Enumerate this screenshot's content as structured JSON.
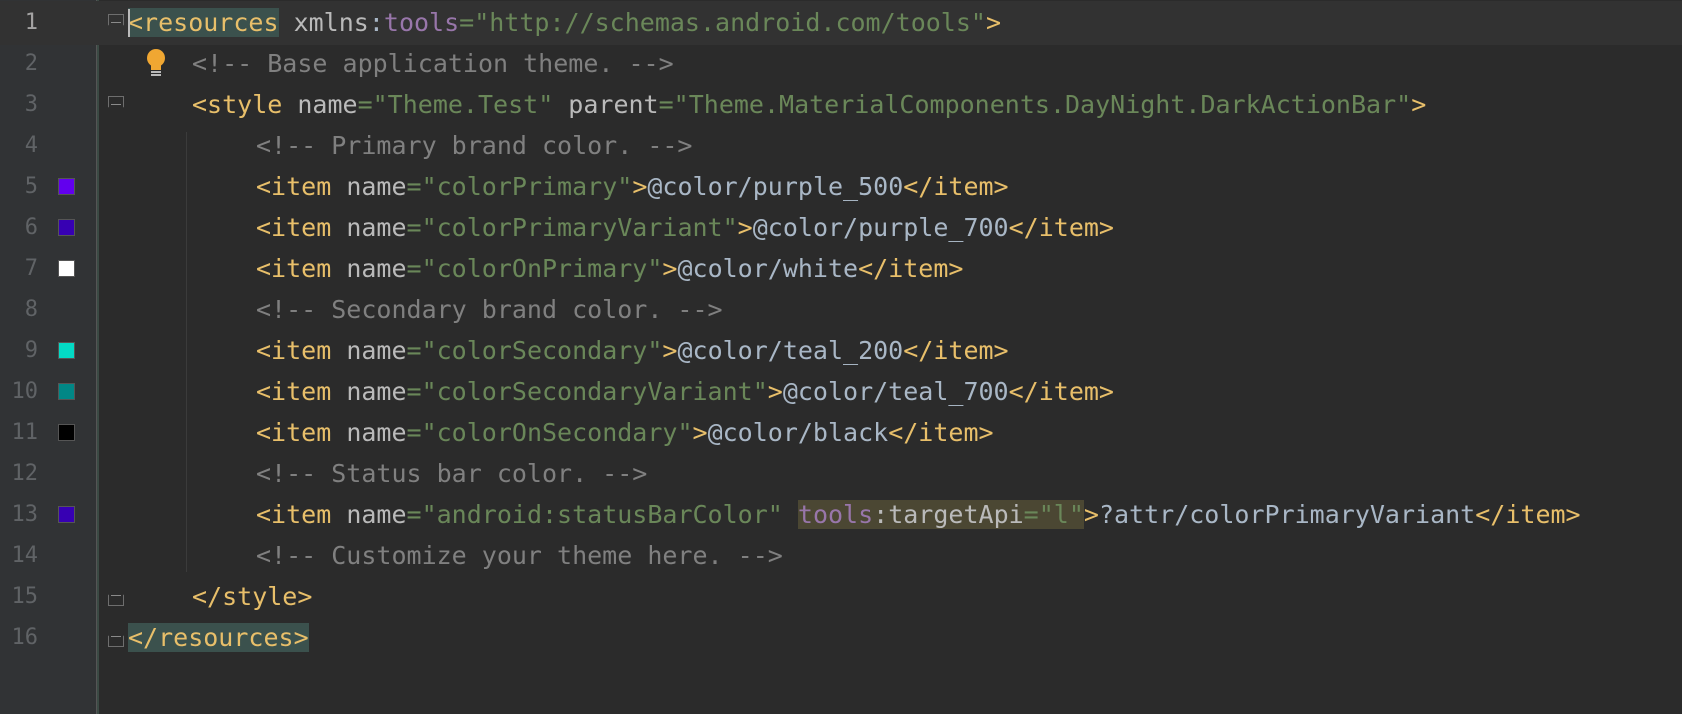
{
  "editor": {
    "file_type": "xml",
    "lines": [
      {
        "n": "1",
        "indent": 0,
        "fold": "start",
        "current": true,
        "tokens": [
          {
            "c": "tag",
            "t": "<resources",
            "hl": "tag"
          },
          {
            "c": "attr",
            "t": " xmlns"
          },
          {
            "c": "txt",
            "t": ":"
          },
          {
            "c": "ns",
            "t": "tools"
          },
          {
            "c": "val",
            "t": "=\"http://schemas.android.com/tools\""
          },
          {
            "c": "tag",
            "t": ">"
          }
        ]
      },
      {
        "n": "2",
        "indent": 1,
        "bulb": true,
        "tokens": [
          {
            "c": "cmt",
            "t": "<!-- Base application theme. -->"
          }
        ]
      },
      {
        "n": "3",
        "indent": 1,
        "fold": "start",
        "tokens": [
          {
            "c": "tag",
            "t": "<style"
          },
          {
            "c": "attr",
            "t": " name"
          },
          {
            "c": "val",
            "t": "=\"Theme.Test\""
          },
          {
            "c": "attr",
            "t": " parent"
          },
          {
            "c": "val",
            "t": "=\"Theme.MaterialComponents.DayNight.DarkActionBar\""
          },
          {
            "c": "tag",
            "t": ">"
          }
        ]
      },
      {
        "n": "4",
        "indent": 2,
        "tokens": [
          {
            "c": "cmt",
            "t": "<!-- Primary brand color. -->"
          }
        ]
      },
      {
        "n": "5",
        "indent": 2,
        "swatch": "#6200ee",
        "tokens": [
          {
            "c": "tag",
            "t": "<item"
          },
          {
            "c": "attr",
            "t": " name"
          },
          {
            "c": "val",
            "t": "=\"colorPrimary\""
          },
          {
            "c": "tag",
            "t": ">"
          },
          {
            "c": "txt",
            "t": "@color/purple_500"
          },
          {
            "c": "tag",
            "t": "</item>"
          }
        ]
      },
      {
        "n": "6",
        "indent": 2,
        "swatch": "#3700b3",
        "tokens": [
          {
            "c": "tag",
            "t": "<item"
          },
          {
            "c": "attr",
            "t": " name"
          },
          {
            "c": "val",
            "t": "=\"colorPrimaryVariant\""
          },
          {
            "c": "tag",
            "t": ">"
          },
          {
            "c": "txt",
            "t": "@color/purple_700"
          },
          {
            "c": "tag",
            "t": "</item>"
          }
        ]
      },
      {
        "n": "7",
        "indent": 2,
        "swatch": "#ffffff",
        "tokens": [
          {
            "c": "tag",
            "t": "<item"
          },
          {
            "c": "attr",
            "t": " name"
          },
          {
            "c": "val",
            "t": "=\"colorOnPrimary\""
          },
          {
            "c": "tag",
            "t": ">"
          },
          {
            "c": "txt",
            "t": "@color/white"
          },
          {
            "c": "tag",
            "t": "</item>"
          }
        ]
      },
      {
        "n": "8",
        "indent": 2,
        "tokens": [
          {
            "c": "cmt",
            "t": "<!-- Secondary brand color. -->"
          }
        ]
      },
      {
        "n": "9",
        "indent": 2,
        "swatch": "#03dac5",
        "tokens": [
          {
            "c": "tag",
            "t": "<item"
          },
          {
            "c": "attr",
            "t": " name"
          },
          {
            "c": "val",
            "t": "=\"colorSecondary\""
          },
          {
            "c": "tag",
            "t": ">"
          },
          {
            "c": "txt",
            "t": "@color/teal_200"
          },
          {
            "c": "tag",
            "t": "</item>"
          }
        ]
      },
      {
        "n": "10",
        "indent": 2,
        "swatch": "#018786",
        "tokens": [
          {
            "c": "tag",
            "t": "<item"
          },
          {
            "c": "attr",
            "t": " name"
          },
          {
            "c": "val",
            "t": "=\"colorSecondaryVariant\""
          },
          {
            "c": "tag",
            "t": ">"
          },
          {
            "c": "txt",
            "t": "@color/teal_700"
          },
          {
            "c": "tag",
            "t": "</item>"
          }
        ]
      },
      {
        "n": "11",
        "indent": 2,
        "swatch": "#000000",
        "tokens": [
          {
            "c": "tag",
            "t": "<item"
          },
          {
            "c": "attr",
            "t": " name"
          },
          {
            "c": "val",
            "t": "=\"colorOnSecondary\""
          },
          {
            "c": "tag",
            "t": ">"
          },
          {
            "c": "txt",
            "t": "@color/black"
          },
          {
            "c": "tag",
            "t": "</item>"
          }
        ]
      },
      {
        "n": "12",
        "indent": 2,
        "tokens": [
          {
            "c": "cmt",
            "t": "<!-- Status bar color. -->"
          }
        ]
      },
      {
        "n": "13",
        "indent": 2,
        "swatch": "#3700b3",
        "tokens": [
          {
            "c": "tag",
            "t": "<item"
          },
          {
            "c": "attr",
            "t": " name"
          },
          {
            "c": "val",
            "t": "=\"android:statusBarColor\""
          },
          {
            "c": "attr",
            "t": " "
          },
          {
            "c": "ns",
            "t": "tools",
            "hl": "attr"
          },
          {
            "c": "attr",
            "t": ":targetApi",
            "hl": "attr"
          },
          {
            "c": "val",
            "t": "=\"l\"",
            "hl": "attr"
          },
          {
            "c": "tag",
            "t": ">"
          },
          {
            "c": "txt",
            "t": "?attr/colorPrimaryVariant"
          },
          {
            "c": "tag",
            "t": "</item>"
          }
        ]
      },
      {
        "n": "14",
        "indent": 2,
        "tokens": [
          {
            "c": "cmt",
            "t": "<!-- Customize your theme here. -->"
          }
        ]
      },
      {
        "n": "15",
        "indent": 1,
        "fold": "end",
        "tokens": [
          {
            "c": "tag",
            "t": "</style>"
          }
        ]
      },
      {
        "n": "16",
        "indent": 0,
        "fold": "end",
        "tokens": [
          {
            "c": "tag",
            "t": "</resources>",
            "hl": "tag"
          }
        ]
      }
    ]
  }
}
